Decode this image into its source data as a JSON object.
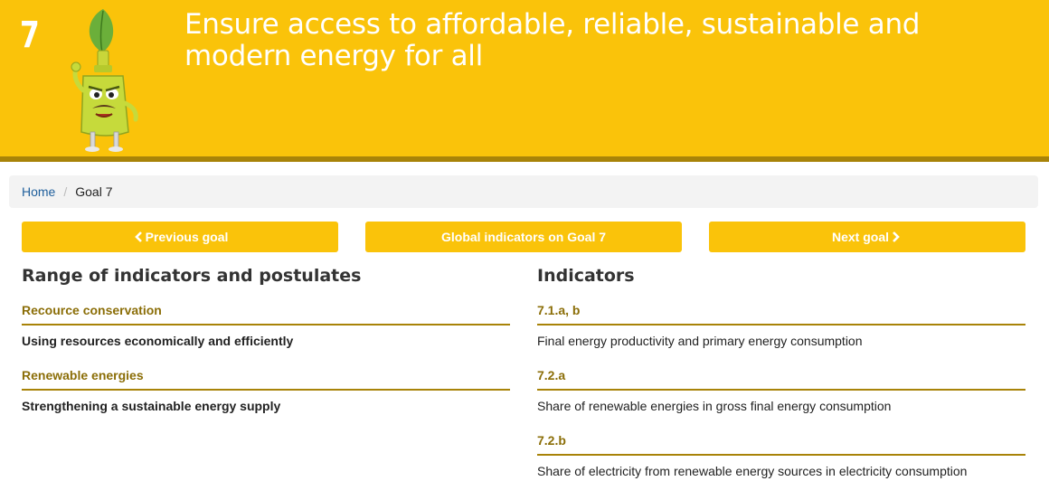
{
  "banner": {
    "goal_number": "7",
    "title": "Ensure access to affordable, reliable, sustainable and modern energy for all",
    "mascot_icon": "energy-plug-mascot",
    "background_color": "#FAC30A",
    "accent_color": "#A88308"
  },
  "breadcrumb": {
    "home": "Home",
    "separator": "/",
    "current": "Goal 7"
  },
  "nav": {
    "previous_label": "Previous goal",
    "previous_icon": "chevron-left-icon",
    "global_label": "Global indicators on Goal 7",
    "next_label": "Next goal",
    "next_icon": "chevron-right-icon"
  },
  "left_column": {
    "heading": "Range of indicators and postulates",
    "items": [
      {
        "title": "Recource conservation",
        "description": "Using resources economically and efficiently"
      },
      {
        "title": "Renewable energies",
        "description": "Strengthening a sustainable energy supply"
      }
    ]
  },
  "right_column": {
    "heading": "Indicators",
    "items": [
      {
        "title": "7.1.a, b",
        "description": "Final energy productivity and primary energy consumption"
      },
      {
        "title": "7.2.a",
        "description": "Share of renewable energies in gross final energy consumption"
      },
      {
        "title": "7.2.b",
        "description": "Share of electricity from renewable energy sources in electricity consumption"
      }
    ]
  }
}
